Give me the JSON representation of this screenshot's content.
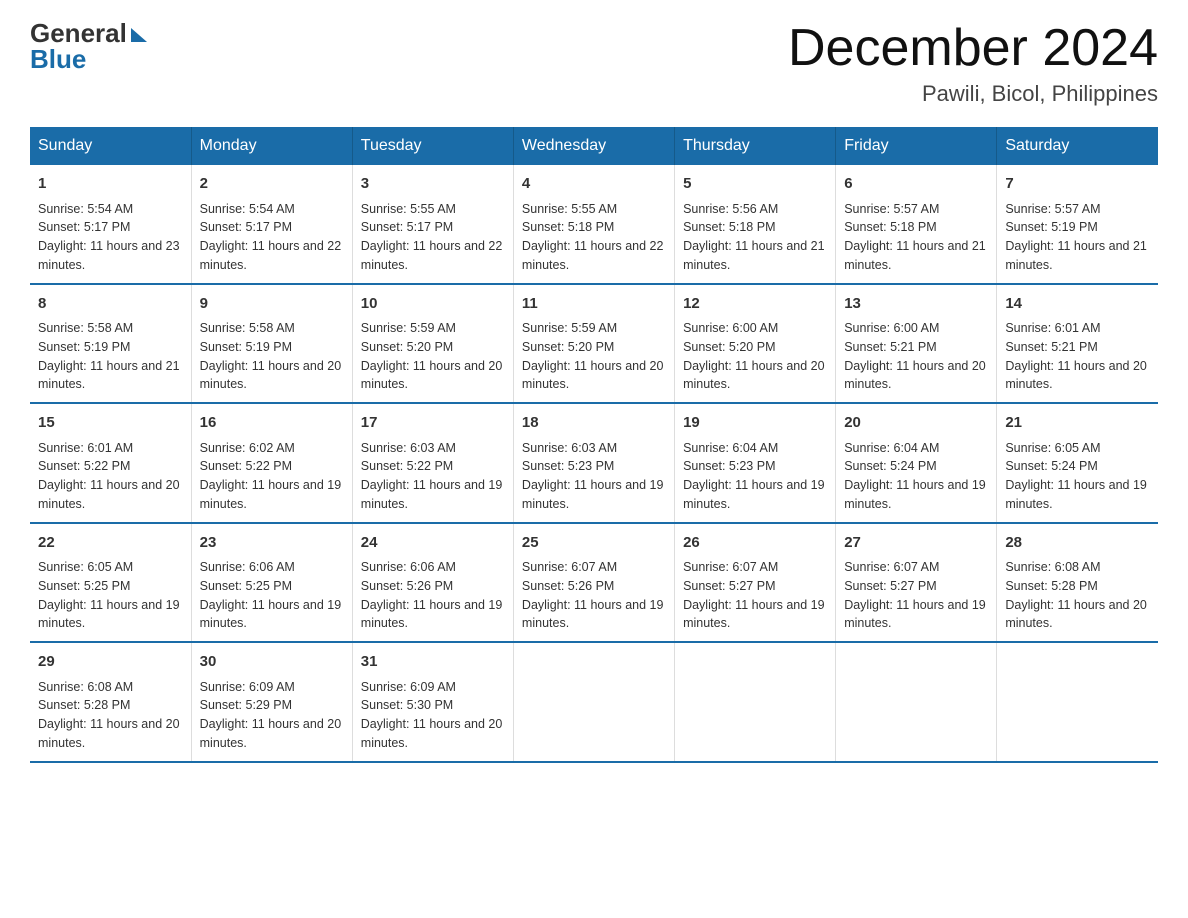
{
  "header": {
    "logo_general": "General",
    "logo_blue": "Blue",
    "month_title": "December 2024",
    "location": "Pawili, Bicol, Philippines"
  },
  "days_of_week": [
    "Sunday",
    "Monday",
    "Tuesday",
    "Wednesday",
    "Thursday",
    "Friday",
    "Saturday"
  ],
  "weeks": [
    [
      {
        "day": "1",
        "sunrise": "Sunrise: 5:54 AM",
        "sunset": "Sunset: 5:17 PM",
        "daylight": "Daylight: 11 hours and 23 minutes."
      },
      {
        "day": "2",
        "sunrise": "Sunrise: 5:54 AM",
        "sunset": "Sunset: 5:17 PM",
        "daylight": "Daylight: 11 hours and 22 minutes."
      },
      {
        "day": "3",
        "sunrise": "Sunrise: 5:55 AM",
        "sunset": "Sunset: 5:17 PM",
        "daylight": "Daylight: 11 hours and 22 minutes."
      },
      {
        "day": "4",
        "sunrise": "Sunrise: 5:55 AM",
        "sunset": "Sunset: 5:18 PM",
        "daylight": "Daylight: 11 hours and 22 minutes."
      },
      {
        "day": "5",
        "sunrise": "Sunrise: 5:56 AM",
        "sunset": "Sunset: 5:18 PM",
        "daylight": "Daylight: 11 hours and 21 minutes."
      },
      {
        "day": "6",
        "sunrise": "Sunrise: 5:57 AM",
        "sunset": "Sunset: 5:18 PM",
        "daylight": "Daylight: 11 hours and 21 minutes."
      },
      {
        "day": "7",
        "sunrise": "Sunrise: 5:57 AM",
        "sunset": "Sunset: 5:19 PM",
        "daylight": "Daylight: 11 hours and 21 minutes."
      }
    ],
    [
      {
        "day": "8",
        "sunrise": "Sunrise: 5:58 AM",
        "sunset": "Sunset: 5:19 PM",
        "daylight": "Daylight: 11 hours and 21 minutes."
      },
      {
        "day": "9",
        "sunrise": "Sunrise: 5:58 AM",
        "sunset": "Sunset: 5:19 PM",
        "daylight": "Daylight: 11 hours and 20 minutes."
      },
      {
        "day": "10",
        "sunrise": "Sunrise: 5:59 AM",
        "sunset": "Sunset: 5:20 PM",
        "daylight": "Daylight: 11 hours and 20 minutes."
      },
      {
        "day": "11",
        "sunrise": "Sunrise: 5:59 AM",
        "sunset": "Sunset: 5:20 PM",
        "daylight": "Daylight: 11 hours and 20 minutes."
      },
      {
        "day": "12",
        "sunrise": "Sunrise: 6:00 AM",
        "sunset": "Sunset: 5:20 PM",
        "daylight": "Daylight: 11 hours and 20 minutes."
      },
      {
        "day": "13",
        "sunrise": "Sunrise: 6:00 AM",
        "sunset": "Sunset: 5:21 PM",
        "daylight": "Daylight: 11 hours and 20 minutes."
      },
      {
        "day": "14",
        "sunrise": "Sunrise: 6:01 AM",
        "sunset": "Sunset: 5:21 PM",
        "daylight": "Daylight: 11 hours and 20 minutes."
      }
    ],
    [
      {
        "day": "15",
        "sunrise": "Sunrise: 6:01 AM",
        "sunset": "Sunset: 5:22 PM",
        "daylight": "Daylight: 11 hours and 20 minutes."
      },
      {
        "day": "16",
        "sunrise": "Sunrise: 6:02 AM",
        "sunset": "Sunset: 5:22 PM",
        "daylight": "Daylight: 11 hours and 19 minutes."
      },
      {
        "day": "17",
        "sunrise": "Sunrise: 6:03 AM",
        "sunset": "Sunset: 5:22 PM",
        "daylight": "Daylight: 11 hours and 19 minutes."
      },
      {
        "day": "18",
        "sunrise": "Sunrise: 6:03 AM",
        "sunset": "Sunset: 5:23 PM",
        "daylight": "Daylight: 11 hours and 19 minutes."
      },
      {
        "day": "19",
        "sunrise": "Sunrise: 6:04 AM",
        "sunset": "Sunset: 5:23 PM",
        "daylight": "Daylight: 11 hours and 19 minutes."
      },
      {
        "day": "20",
        "sunrise": "Sunrise: 6:04 AM",
        "sunset": "Sunset: 5:24 PM",
        "daylight": "Daylight: 11 hours and 19 minutes."
      },
      {
        "day": "21",
        "sunrise": "Sunrise: 6:05 AM",
        "sunset": "Sunset: 5:24 PM",
        "daylight": "Daylight: 11 hours and 19 minutes."
      }
    ],
    [
      {
        "day": "22",
        "sunrise": "Sunrise: 6:05 AM",
        "sunset": "Sunset: 5:25 PM",
        "daylight": "Daylight: 11 hours and 19 minutes."
      },
      {
        "day": "23",
        "sunrise": "Sunrise: 6:06 AM",
        "sunset": "Sunset: 5:25 PM",
        "daylight": "Daylight: 11 hours and 19 minutes."
      },
      {
        "day": "24",
        "sunrise": "Sunrise: 6:06 AM",
        "sunset": "Sunset: 5:26 PM",
        "daylight": "Daylight: 11 hours and 19 minutes."
      },
      {
        "day": "25",
        "sunrise": "Sunrise: 6:07 AM",
        "sunset": "Sunset: 5:26 PM",
        "daylight": "Daylight: 11 hours and 19 minutes."
      },
      {
        "day": "26",
        "sunrise": "Sunrise: 6:07 AM",
        "sunset": "Sunset: 5:27 PM",
        "daylight": "Daylight: 11 hours and 19 minutes."
      },
      {
        "day": "27",
        "sunrise": "Sunrise: 6:07 AM",
        "sunset": "Sunset: 5:27 PM",
        "daylight": "Daylight: 11 hours and 19 minutes."
      },
      {
        "day": "28",
        "sunrise": "Sunrise: 6:08 AM",
        "sunset": "Sunset: 5:28 PM",
        "daylight": "Daylight: 11 hours and 20 minutes."
      }
    ],
    [
      {
        "day": "29",
        "sunrise": "Sunrise: 6:08 AM",
        "sunset": "Sunset: 5:28 PM",
        "daylight": "Daylight: 11 hours and 20 minutes."
      },
      {
        "day": "30",
        "sunrise": "Sunrise: 6:09 AM",
        "sunset": "Sunset: 5:29 PM",
        "daylight": "Daylight: 11 hours and 20 minutes."
      },
      {
        "day": "31",
        "sunrise": "Sunrise: 6:09 AM",
        "sunset": "Sunset: 5:30 PM",
        "daylight": "Daylight: 11 hours and 20 minutes."
      },
      {
        "day": "",
        "sunrise": "",
        "sunset": "",
        "daylight": ""
      },
      {
        "day": "",
        "sunrise": "",
        "sunset": "",
        "daylight": ""
      },
      {
        "day": "",
        "sunrise": "",
        "sunset": "",
        "daylight": ""
      },
      {
        "day": "",
        "sunrise": "",
        "sunset": "",
        "daylight": ""
      }
    ]
  ]
}
